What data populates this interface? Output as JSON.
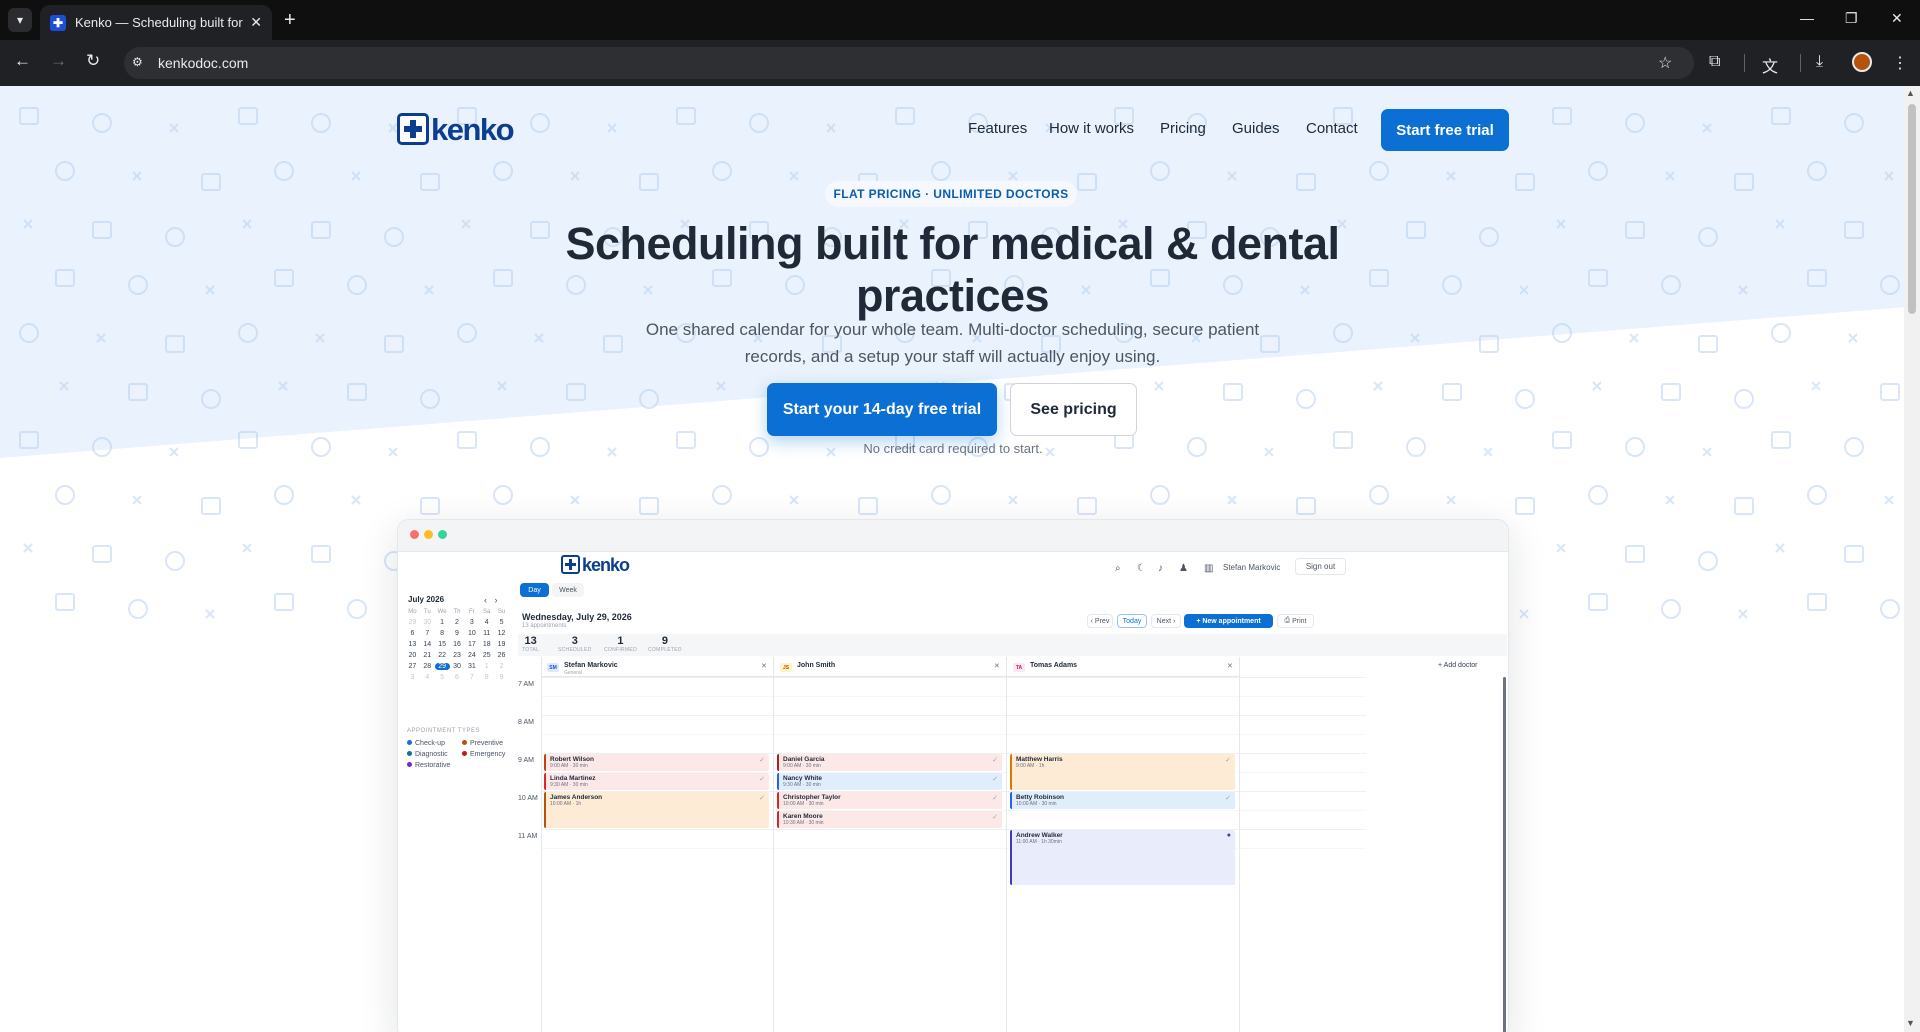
{
  "browser": {
    "tab_title": "Kenko — Scheduling built for medical & dental practices",
    "tab_favicon": "✚",
    "url": "kenkodoc.com"
  },
  "site": {
    "logo_text": "kenko",
    "nav": [
      "Features",
      "How it works",
      "Pricing",
      "Guides",
      "Contact"
    ],
    "nav_cta": "Start free trial"
  },
  "hero": {
    "badge": "FLAT PRICING · UNLIMITED DOCTORS",
    "title": "Scheduling built for medical & dental practices",
    "subtitle": "One shared calendar for your whole team. Multi-doctor scheduling, secure patient records, and a setup your staff will actually enjoy using.",
    "primary_cta": "Start your 14-day free trial",
    "secondary_cta": "See pricing",
    "note": "No credit card required to start."
  },
  "app": {
    "logo_text": "kenko",
    "user": "Stefan Markovic",
    "sign_out": "Sign out",
    "views": [
      "Day",
      "Week"
    ],
    "mini_cal": {
      "month": "July 2026",
      "dow": [
        "Mo",
        "Tu",
        "We",
        "Th",
        "Fr",
        "Sa",
        "Su"
      ],
      "weeks": [
        [
          "29",
          "30",
          "1",
          "2",
          "3",
          "4",
          "5"
        ],
        [
          "6",
          "7",
          "8",
          "9",
          "10",
          "11",
          "12"
        ],
        [
          "13",
          "14",
          "15",
          "16",
          "17",
          "18",
          "19"
        ],
        [
          "20",
          "21",
          "22",
          "23",
          "24",
          "25",
          "26"
        ],
        [
          "27",
          "28",
          "29",
          "30",
          "31",
          "1",
          "2"
        ],
        [
          "3",
          "4",
          "5",
          "6",
          "7",
          "8",
          "9"
        ]
      ],
      "selected": "29"
    },
    "types_title": "APPOINTMENT TYPES",
    "types": [
      {
        "label": "Check-up",
        "color": "#2563eb"
      },
      {
        "label": "Preventive",
        "color": "#b45309"
      },
      {
        "label": "Diagnostic",
        "color": "#0e7490"
      },
      {
        "label": "Emergency",
        "color": "#b91c1c"
      },
      {
        "label": "Restorative",
        "color": "#6d28d9"
      }
    ],
    "date_title": "Wednesday, July 29, 2026",
    "date_sub": "13 appointments",
    "controls": {
      "prev": "‹ Prev",
      "today": "Today",
      "next": "Next ›",
      "new": "+ New appointment",
      "print": "Print"
    },
    "stats": [
      {
        "n": "13",
        "l": "TOTAL"
      },
      {
        "n": "3",
        "l": "SCHEDULED"
      },
      {
        "n": "1",
        "l": "CONFIRMED"
      },
      {
        "n": "9",
        "l": "COMPLETED"
      }
    ],
    "doctors": [
      {
        "initials": "SM",
        "name": "Stefan Markovic",
        "sub": "General"
      },
      {
        "initials": "JS",
        "name": "John Smith",
        "sub": ""
      },
      {
        "initials": "TA",
        "name": "Tomas Adams",
        "sub": ""
      }
    ],
    "add_doctor": "+ Add doctor",
    "hours": [
      "7 AM",
      "8 AM",
      "9 AM",
      "10 AM",
      "11 AM"
    ],
    "appointments": [
      {
        "name": "Robert Wilson",
        "time": "9:00 AM · 30 min",
        "col": 0
      },
      {
        "name": "Linda Martinez",
        "time": "9:30 AM · 30 min",
        "col": 0
      },
      {
        "name": "James Anderson",
        "time": "10:00 AM · 1h",
        "col": 0
      },
      {
        "name": "Daniel Garcia",
        "time": "9:00 AM · 30 min",
        "col": 1
      },
      {
        "name": "Nancy White",
        "time": "9:30 AM · 30 min",
        "col": 1
      },
      {
        "name": "Christopher Taylor",
        "time": "10:00 AM · 30 min",
        "col": 1
      },
      {
        "name": "Karen Moore",
        "time": "10:30 AM · 30 min",
        "col": 1
      },
      {
        "name": "Matthew Harris",
        "time": "9:00 AM · 1h",
        "col": 2
      },
      {
        "name": "Betty Robinson",
        "time": "10:00 AM · 30 min",
        "col": 2
      },
      {
        "name": "Andrew Walker",
        "time": "11:00 AM · 1h 30min",
        "col": 2
      }
    ]
  },
  "colors": {
    "primary": "#0b6fd4",
    "brand": "#0b3d91",
    "hero_bg": "#e9f2fd"
  }
}
